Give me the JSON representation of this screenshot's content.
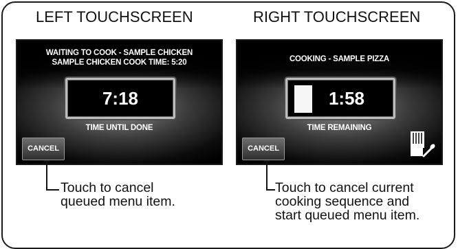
{
  "headings": {
    "left": "LEFT TOUCHSCREEN",
    "right": "RIGHT TOUCHSCREEN"
  },
  "left_screen": {
    "line1": "WAITING TO COOK - SAMPLE CHICKEN",
    "line2": "SAMPLE CHICKEN COOK TIME: 5:20",
    "time": "7:18",
    "time_label": "TIME UNTIL DONE",
    "cancel_label": "CANCEL"
  },
  "right_screen": {
    "line1": "COOKING - SAMPLE PIZZA",
    "time": "1:58",
    "time_label": "TIME REMAINING",
    "cancel_label": "CANCEL",
    "icon": "chef-hat-spoon-icon"
  },
  "captions": {
    "left": [
      "Touch to cancel",
      "queued menu item."
    ],
    "right": [
      "Touch to cancel current",
      "cooking sequence and",
      "start queued menu item."
    ]
  },
  "colors": {
    "screen_background": "#000000",
    "text": "#ffffff",
    "frame": "#1a1a1a"
  }
}
